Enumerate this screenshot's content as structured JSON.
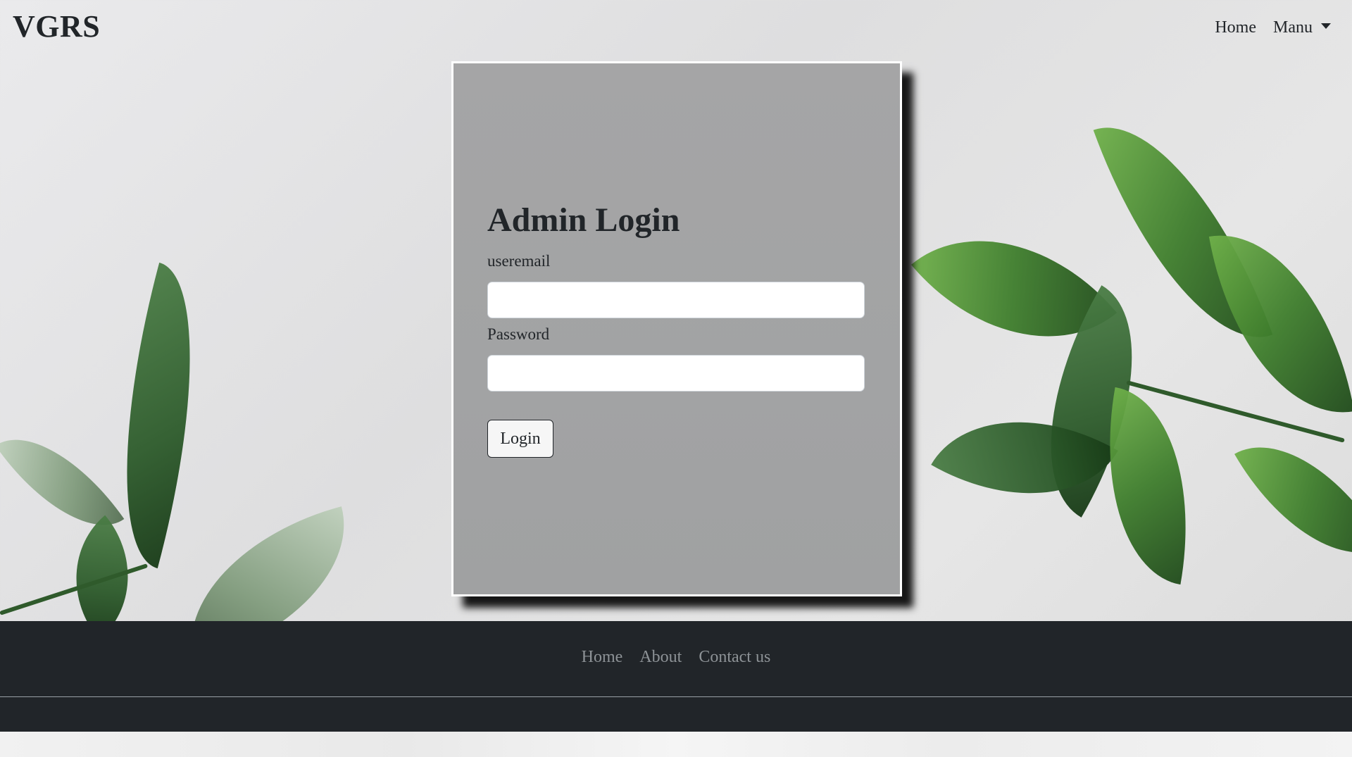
{
  "header": {
    "brand": "VGRS",
    "nav": {
      "home": "Home",
      "menu": "Manu"
    }
  },
  "login": {
    "title": "Admin Login",
    "email_label": "useremail",
    "email_value": "",
    "password_label": "Password",
    "password_value": "",
    "submit_label": "Login"
  },
  "footer": {
    "links": [
      "Home",
      "About",
      "Contact us"
    ]
  },
  "icons": {
    "menu_caret": "caret-down-icon"
  },
  "colors": {
    "footer_bg": "#212529",
    "card_bg": "#a3a4a5",
    "text": "#212529"
  }
}
